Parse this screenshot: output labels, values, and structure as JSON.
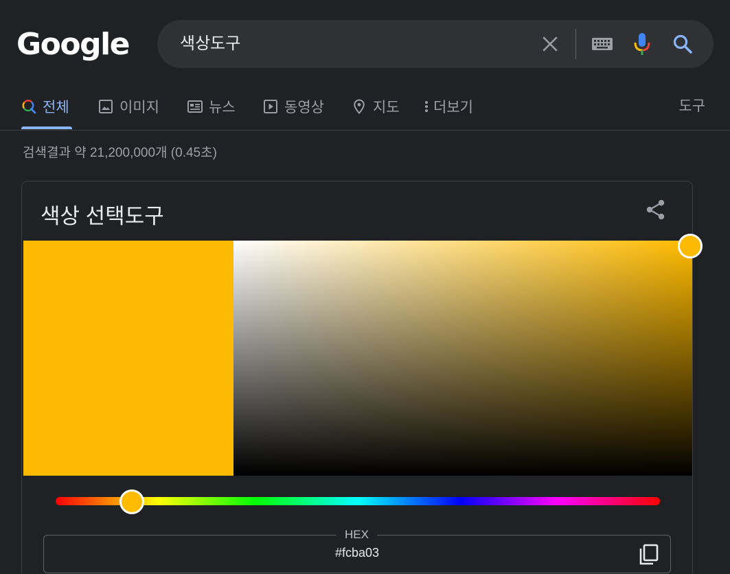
{
  "logo": "Google",
  "search": {
    "query": "색상도구",
    "icons": [
      "clear-icon",
      "keyboard-icon",
      "mic-icon",
      "search-icon"
    ]
  },
  "tabs": [
    {
      "label": "전체",
      "icon": "search-icon",
      "active": true
    },
    {
      "label": "이미지",
      "icon": "image-icon"
    },
    {
      "label": "뉴스",
      "icon": "news-icon"
    },
    {
      "label": "동영상",
      "icon": "play-icon"
    },
    {
      "label": "지도",
      "icon": "map-pin-icon"
    },
    {
      "label": "더보기",
      "icon": "more-vert-icon"
    }
  ],
  "tools_label": "도구",
  "result_stats": "검색결과 약 21,200,000개 (0.45초)",
  "color_picker": {
    "title": "색상 선택도구",
    "hex_label": "HEX",
    "hex_value": "#fcba03",
    "selected_color": "#fcba03",
    "hue_color": "#ffbb00",
    "hue_position": 0.125,
    "saturation": 1.0,
    "brightness": 0.99
  },
  "colors": {
    "background": "#202124",
    "accent": "#8ab4f8",
    "searchbar": "#303134"
  }
}
